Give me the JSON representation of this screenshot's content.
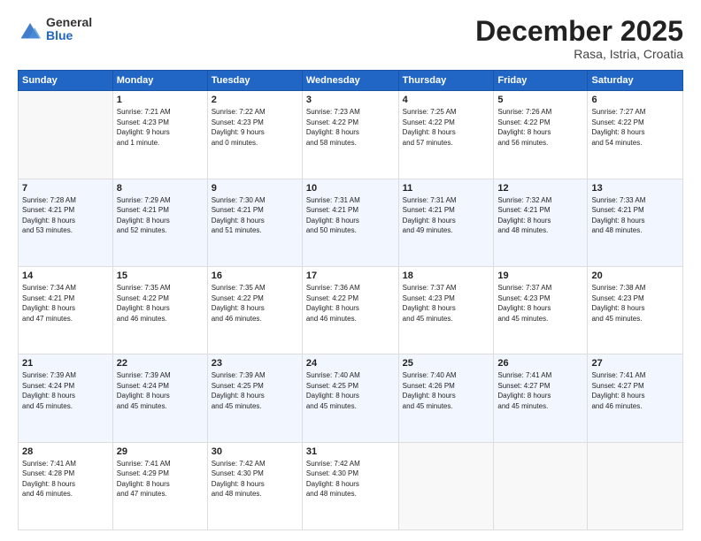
{
  "header": {
    "logo_general": "General",
    "logo_blue": "Blue",
    "month_title": "December 2025",
    "subtitle": "Rasa, Istria, Croatia"
  },
  "days_of_week": [
    "Sunday",
    "Monday",
    "Tuesday",
    "Wednesday",
    "Thursday",
    "Friday",
    "Saturday"
  ],
  "weeks": [
    [
      {
        "day": "",
        "sunrise": "",
        "sunset": "",
        "daylight": ""
      },
      {
        "day": "1",
        "sunrise": "Sunrise: 7:21 AM",
        "sunset": "Sunset: 4:23 PM",
        "daylight": "Daylight: 9 hours and 1 minute."
      },
      {
        "day": "2",
        "sunrise": "Sunrise: 7:22 AM",
        "sunset": "Sunset: 4:23 PM",
        "daylight": "Daylight: 9 hours and 0 minutes."
      },
      {
        "day": "3",
        "sunrise": "Sunrise: 7:23 AM",
        "sunset": "Sunset: 4:22 PM",
        "daylight": "Daylight: 8 hours and 58 minutes."
      },
      {
        "day": "4",
        "sunrise": "Sunrise: 7:25 AM",
        "sunset": "Sunset: 4:22 PM",
        "daylight": "Daylight: 8 hours and 57 minutes."
      },
      {
        "day": "5",
        "sunrise": "Sunrise: 7:26 AM",
        "sunset": "Sunset: 4:22 PM",
        "daylight": "Daylight: 8 hours and 56 minutes."
      },
      {
        "day": "6",
        "sunrise": "Sunrise: 7:27 AM",
        "sunset": "Sunset: 4:22 PM",
        "daylight": "Daylight: 8 hours and 54 minutes."
      }
    ],
    [
      {
        "day": "7",
        "sunrise": "Sunrise: 7:28 AM",
        "sunset": "Sunset: 4:21 PM",
        "daylight": "Daylight: 8 hours and 53 minutes."
      },
      {
        "day": "8",
        "sunrise": "Sunrise: 7:29 AM",
        "sunset": "Sunset: 4:21 PM",
        "daylight": "Daylight: 8 hours and 52 minutes."
      },
      {
        "day": "9",
        "sunrise": "Sunrise: 7:30 AM",
        "sunset": "Sunset: 4:21 PM",
        "daylight": "Daylight: 8 hours and 51 minutes."
      },
      {
        "day": "10",
        "sunrise": "Sunrise: 7:31 AM",
        "sunset": "Sunset: 4:21 PM",
        "daylight": "Daylight: 8 hours and 50 minutes."
      },
      {
        "day": "11",
        "sunrise": "Sunrise: 7:31 AM",
        "sunset": "Sunset: 4:21 PM",
        "daylight": "Daylight: 8 hours and 49 minutes."
      },
      {
        "day": "12",
        "sunrise": "Sunrise: 7:32 AM",
        "sunset": "Sunset: 4:21 PM",
        "daylight": "Daylight: 8 hours and 48 minutes."
      },
      {
        "day": "13",
        "sunrise": "Sunrise: 7:33 AM",
        "sunset": "Sunset: 4:21 PM",
        "daylight": "Daylight: 8 hours and 48 minutes."
      }
    ],
    [
      {
        "day": "14",
        "sunrise": "Sunrise: 7:34 AM",
        "sunset": "Sunset: 4:21 PM",
        "daylight": "Daylight: 8 hours and 47 minutes."
      },
      {
        "day": "15",
        "sunrise": "Sunrise: 7:35 AM",
        "sunset": "Sunset: 4:22 PM",
        "daylight": "Daylight: 8 hours and 46 minutes."
      },
      {
        "day": "16",
        "sunrise": "Sunrise: 7:35 AM",
        "sunset": "Sunset: 4:22 PM",
        "daylight": "Daylight: 8 hours and 46 minutes."
      },
      {
        "day": "17",
        "sunrise": "Sunrise: 7:36 AM",
        "sunset": "Sunset: 4:22 PM",
        "daylight": "Daylight: 8 hours and 46 minutes."
      },
      {
        "day": "18",
        "sunrise": "Sunrise: 7:37 AM",
        "sunset": "Sunset: 4:23 PM",
        "daylight": "Daylight: 8 hours and 45 minutes."
      },
      {
        "day": "19",
        "sunrise": "Sunrise: 7:37 AM",
        "sunset": "Sunset: 4:23 PM",
        "daylight": "Daylight: 8 hours and 45 minutes."
      },
      {
        "day": "20",
        "sunrise": "Sunrise: 7:38 AM",
        "sunset": "Sunset: 4:23 PM",
        "daylight": "Daylight: 8 hours and 45 minutes."
      }
    ],
    [
      {
        "day": "21",
        "sunrise": "Sunrise: 7:39 AM",
        "sunset": "Sunset: 4:24 PM",
        "daylight": "Daylight: 8 hours and 45 minutes."
      },
      {
        "day": "22",
        "sunrise": "Sunrise: 7:39 AM",
        "sunset": "Sunset: 4:24 PM",
        "daylight": "Daylight: 8 hours and 45 minutes."
      },
      {
        "day": "23",
        "sunrise": "Sunrise: 7:39 AM",
        "sunset": "Sunset: 4:25 PM",
        "daylight": "Daylight: 8 hours and 45 minutes."
      },
      {
        "day": "24",
        "sunrise": "Sunrise: 7:40 AM",
        "sunset": "Sunset: 4:25 PM",
        "daylight": "Daylight: 8 hours and 45 minutes."
      },
      {
        "day": "25",
        "sunrise": "Sunrise: 7:40 AM",
        "sunset": "Sunset: 4:26 PM",
        "daylight": "Daylight: 8 hours and 45 minutes."
      },
      {
        "day": "26",
        "sunrise": "Sunrise: 7:41 AM",
        "sunset": "Sunset: 4:27 PM",
        "daylight": "Daylight: 8 hours and 45 minutes."
      },
      {
        "day": "27",
        "sunrise": "Sunrise: 7:41 AM",
        "sunset": "Sunset: 4:27 PM",
        "daylight": "Daylight: 8 hours and 46 minutes."
      }
    ],
    [
      {
        "day": "28",
        "sunrise": "Sunrise: 7:41 AM",
        "sunset": "Sunset: 4:28 PM",
        "daylight": "Daylight: 8 hours and 46 minutes."
      },
      {
        "day": "29",
        "sunrise": "Sunrise: 7:41 AM",
        "sunset": "Sunset: 4:29 PM",
        "daylight": "Daylight: 8 hours and 47 minutes."
      },
      {
        "day": "30",
        "sunrise": "Sunrise: 7:42 AM",
        "sunset": "Sunset: 4:30 PM",
        "daylight": "Daylight: 8 hours and 48 minutes."
      },
      {
        "day": "31",
        "sunrise": "Sunrise: 7:42 AM",
        "sunset": "Sunset: 4:30 PM",
        "daylight": "Daylight: 8 hours and 48 minutes."
      },
      {
        "day": "",
        "sunrise": "",
        "sunset": "",
        "daylight": ""
      },
      {
        "day": "",
        "sunrise": "",
        "sunset": "",
        "daylight": ""
      },
      {
        "day": "",
        "sunrise": "",
        "sunset": "",
        "daylight": ""
      }
    ]
  ]
}
